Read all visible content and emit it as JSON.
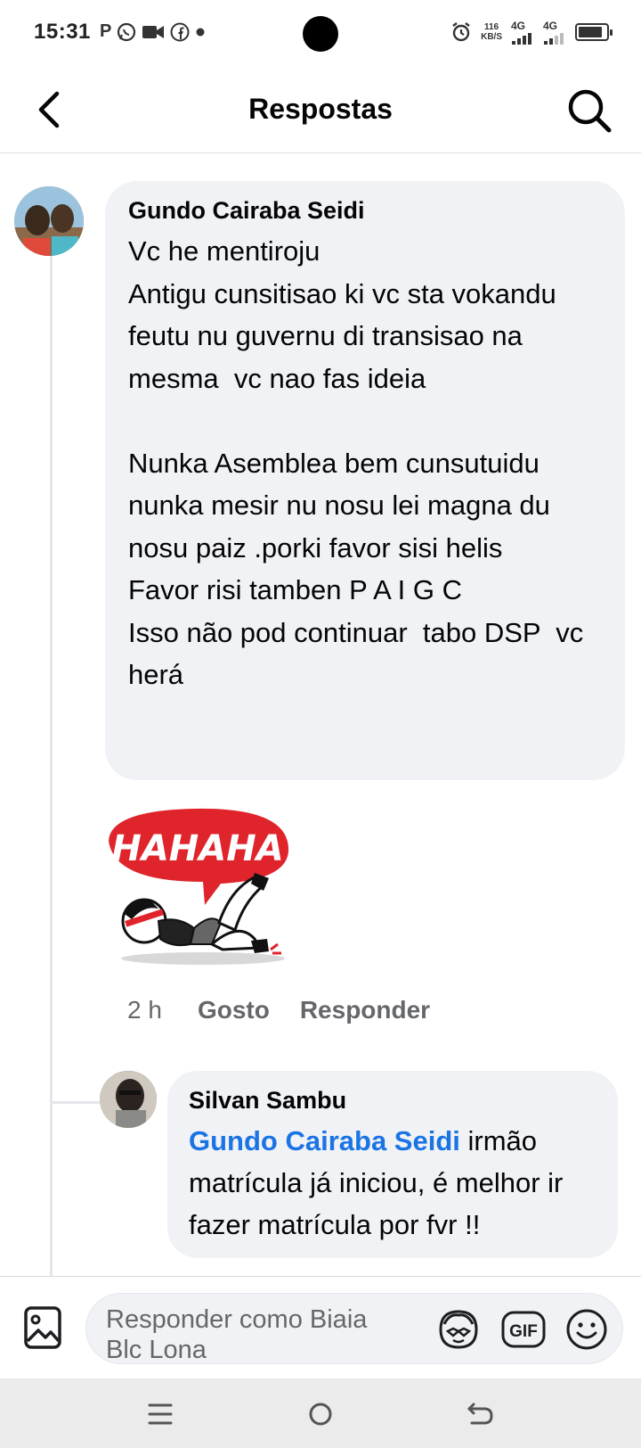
{
  "status_bar": {
    "time": "15:31",
    "notification_icons": [
      "parking-icon",
      "whatsapp-icon",
      "video-icon",
      "facebook-icon",
      "dot-icon"
    ],
    "speed_value": "116",
    "speed_unit": "KB/S",
    "network_1": "4G",
    "network_2": "4G",
    "battery_level": 0.85
  },
  "header": {
    "title": "Respostas"
  },
  "comment": {
    "author": "Gundo Cairaba Seidi",
    "text": "Vc he mentiroju\nAntigu cunsitisao ki vc sta vokandu feutu nu guvernu di transisao na mesma  vc nao fas ideia\n\nNunka Asemblea bem cunsutuidu nunka mesir nu nosu lei magna du nosu paiz .porki favor sisi helis\nFavor risi tamben P A I G C\nIsso não pod continuar  tabo DSP  vc herá",
    "sticker_text": "HAHAHA",
    "time": "2 h",
    "like_label": "Gosto",
    "reply_label": "Responder"
  },
  "reply": {
    "author": "Silvan Sambu",
    "mention": "Gundo Cairaba Seidi",
    "text": " irmão matrícula já iniciou, é melhor ir fazer matrícula por fvr !!"
  },
  "composer": {
    "placeholder": "Responder como Biaia Blc Lona",
    "gif_label": "GIF"
  },
  "colors": {
    "bubble": "#f0f2f5",
    "mention": "#1b74e4",
    "secondary_text": "#65676b",
    "sticker_red": "#e0242c"
  }
}
